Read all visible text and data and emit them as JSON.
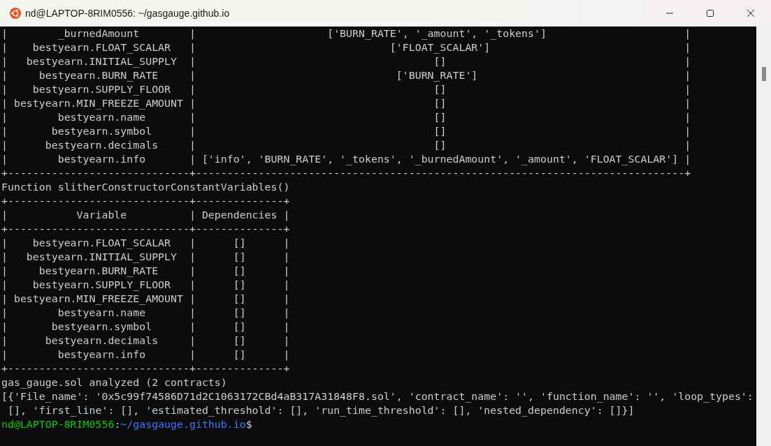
{
  "window": {
    "title": "nd@LAPTOP-8RIM0556: ~/gasgauge.github.io"
  },
  "terminal": {
    "lines": [
      "|        _burnedAmount        |                     ['BURN_RATE', '_amount', '_tokens']                      |",
      "|    bestyearn.FLOAT_SCALAR   |                               ['FLOAT_SCALAR']                               |",
      "|   bestyearn.INITIAL_SUPPLY  |                                      []                                      |",
      "|     bestyearn.BURN_RATE     |                                ['BURN_RATE']                                 |",
      "|    bestyearn.SUPPLY_FLOOR   |                                      []                                      |",
      "| bestyearn.MIN_FREEZE_AMOUNT |                                      []                                      |",
      "|        bestyearn.name       |                                      []                                      |",
      "|       bestyearn.symbol      |                                      []                                      |",
      "|      bestyearn.decimals     |                                      []                                      |",
      "|        bestyearn.info       | ['info', 'BURN_RATE', '_tokens', '_burnedAmount', '_amount', 'FLOAT_SCALAR'] |",
      "+-----------------------------+------------------------------------------------------------------------------+",
      "Function slitherConstructorConstantVariables()",
      "+-----------------------------+--------------+",
      "|           Variable          | Dependencies |",
      "+-----------------------------+--------------+",
      "|    bestyearn.FLOAT_SCALAR   |      []      |",
      "|   bestyearn.INITIAL_SUPPLY  |      []      |",
      "|     bestyearn.BURN_RATE     |      []      |",
      "|    bestyearn.SUPPLY_FLOOR   |      []      |",
      "| bestyearn.MIN_FREEZE_AMOUNT |      []      |",
      "|        bestyearn.name       |      []      |",
      "|       bestyearn.symbol      |      []      |",
      "|      bestyearn.decimals     |      []      |",
      "|        bestyearn.info       |      []      |",
      "+-----------------------------+--------------+",
      "gas_gauge.sol analyzed (2 contracts)",
      "[{'File_name': '0x5c99f74586D71d2C1063172CBd4aB317A31848F8.sol', 'contract_name': '', 'function_name': '', 'loop_types':",
      " [], 'first_line': [], 'estimated_threshold': [], 'run_time_threshold': [], 'nested_dependency': []}]"
    ],
    "prompt": {
      "user_host": "nd@LAPTOP-8RIM0556",
      "separator": ":",
      "path": "~/gasgauge.github.io",
      "symbol": "$"
    }
  }
}
